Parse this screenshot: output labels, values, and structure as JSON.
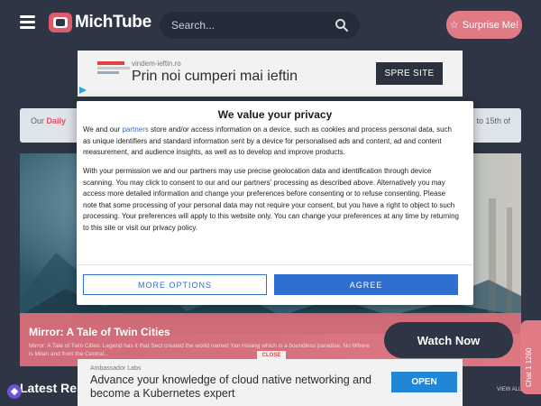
{
  "header": {
    "logo_text": "MichTube",
    "search_placeholder": "Search...",
    "surprise_label": "Surprise Me!",
    "icons": [
      "menu-icon",
      "search-icon",
      "star-icon"
    ]
  },
  "ad_top": {
    "domain": "vindem-ieftin.ro",
    "title": "Prin noi cumperi mai ieftin",
    "button": "SPRE SITE"
  },
  "info_bar": {
    "left_prefix": "Our",
    "left_highlight": "Daily",
    "right_text": "to 15th of"
  },
  "hero": {
    "title": "Mirror: A Tale of Twin Cities",
    "description": "Mirror: A Tale of Twin Cities: Legend has it that Sect created the world named Yan Hsiang which is a boundless paradise, No Where is Milan and from the Central...",
    "watch_label": "Watch Now"
  },
  "side_tab": {
    "label": "Chat 1 1260"
  },
  "latest": {
    "title": "Latest Rele",
    "view_all": "VIEW ALL"
  },
  "ad_bottom": {
    "domain": "Ambassador Labs",
    "title": "Advance your knowledge of cloud native networking and become a Kubernetes expert",
    "button": "OPEN",
    "close_label": "CLOSE"
  },
  "consent": {
    "title": "We value your privacy",
    "p1_before": "We and our ",
    "p1_link": "partners",
    "p1_after": " store and/or access information on a device, such as cookies and process personal data, such as unique identifiers and standard information sent by a device for personalised ads and content, ad and content measurement, and audience insights, as well as to develop and improve products.",
    "p2": "With your permission we and our partners may use precise geolocation data and identification through device scanning. You may click to consent to our and our partners' processing as described above. Alternatively you may access more detailed information and change your preferences before consenting or to refuse consenting. Please note that some processing of your personal data may not require your consent, but you have a right to object to such processing. Your preferences will apply to this website only. You can change your preferences at any time by returning to this site or visit our privacy policy.",
    "more_options": "MORE OPTIONS",
    "agree": "AGREE"
  },
  "colors": {
    "background": "#2e3544",
    "accent": "#e07b85",
    "consent_blue": "#2f6fcf"
  }
}
